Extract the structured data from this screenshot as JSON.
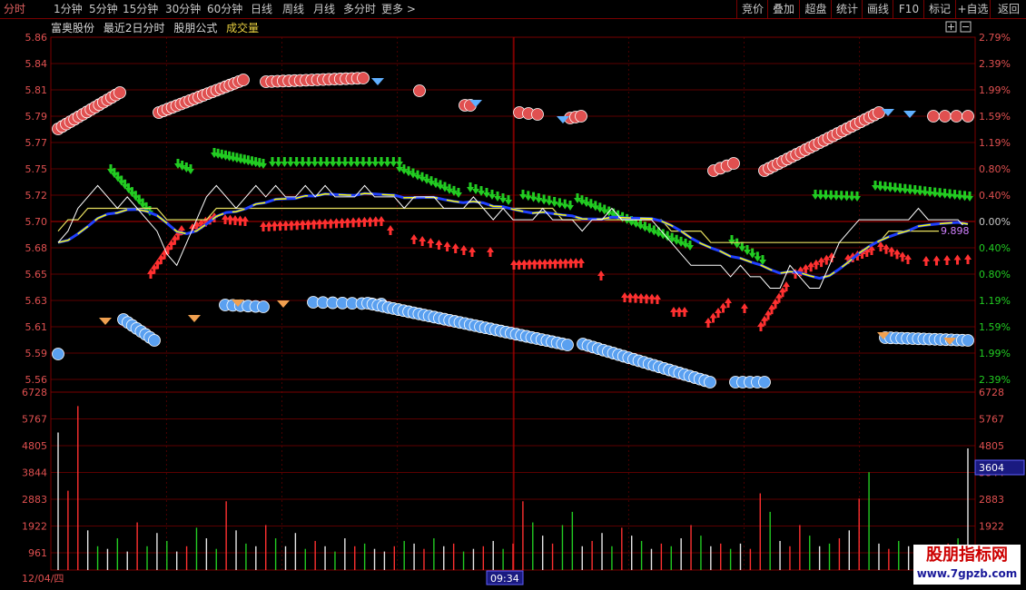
{
  "toolbar": {
    "left": [
      "分时",
      "1分钟",
      "5分钟",
      "15分钟",
      "30分钟",
      "60分钟",
      "日线",
      "周线",
      "月线",
      "多分时",
      "更多 >"
    ],
    "right": [
      "竞价",
      "叠加",
      "超盘",
      "统计",
      "画线",
      "F10",
      "标记",
      "+自选",
      "返回"
    ]
  },
  "info": {
    "stock": "富奥股份",
    "mode": "最近2日分时",
    "formula": "股朋公式",
    "indicator": "成交量"
  },
  "price_axis": {
    "left": [
      "5.86",
      "5.84",
      "5.81",
      "5.79",
      "5.77",
      "5.75",
      "5.72",
      "5.70",
      "5.68",
      "5.65",
      "5.63",
      "5.61",
      "5.59",
      "5.56"
    ],
    "right": [
      "2.79%",
      "2.39%",
      "1.99%",
      "1.59%",
      "1.19%",
      "0.80%",
      "0.40%",
      "0.00%",
      "0.40%",
      "0.80%",
      "1.19%",
      "1.59%",
      "1.99%",
      "2.39%"
    ],
    "last_label": "9.898"
  },
  "volume_axis": {
    "ticks": [
      "6728",
      "5767",
      "4805",
      "3844",
      "2883",
      "1922",
      "961"
    ],
    "current": "3604"
  },
  "time_axis": {
    "date": "12/04/四",
    "cursor": "09:34"
  },
  "colors": {
    "grid": "#7a0000",
    "up": "#ff3030",
    "down": "#22cc22",
    "price_line": "#ffffff",
    "avg_line": "#ffff00",
    "ma_blue": "#2040ff",
    "sell_ball": "#e05050",
    "buy_ball": "#5aa0f0"
  },
  "chart_data": {
    "type": "line",
    "price_range": [
      5.56,
      5.86
    ],
    "prev_close": 5.7,
    "volume_range": [
      0,
      6728
    ],
    "price": [
      5.68,
      5.69,
      5.71,
      5.72,
      5.73,
      5.72,
      5.71,
      5.72,
      5.71,
      5.7,
      5.69,
      5.67,
      5.66,
      5.68,
      5.7,
      5.72,
      5.73,
      5.72,
      5.71,
      5.72,
      5.73,
      5.72,
      5.73,
      5.72,
      5.72,
      5.73,
      5.72,
      5.73,
      5.72,
      5.72,
      5.72,
      5.73,
      5.72,
      5.72,
      5.72,
      5.71,
      5.72,
      5.72,
      5.72,
      5.71,
      5.71,
      5.71,
      5.72,
      5.71,
      5.7,
      5.71,
      5.7,
      5.7,
      5.7,
      5.71,
      5.7,
      5.7,
      5.7,
      5.69,
      5.7,
      5.7,
      5.71,
      5.7,
      5.7,
      5.7,
      5.7,
      5.69,
      5.68,
      5.67,
      5.66,
      5.66,
      5.66,
      5.66,
      5.65,
      5.66,
      5.65,
      5.65,
      5.64,
      5.64,
      5.66,
      5.65,
      5.64,
      5.64,
      5.66,
      5.68,
      5.69,
      5.7,
      5.7,
      5.7,
      5.7,
      5.7,
      5.7,
      5.71,
      5.7,
      5.7,
      5.7,
      5.7,
      5.69
    ],
    "avg": [
      5.69,
      5.7,
      5.7,
      5.71,
      5.71,
      5.71,
      5.71,
      5.71,
      5.71,
      5.71,
      5.71,
      5.7,
      5.7,
      5.7,
      5.7,
      5.7,
      5.71,
      5.71,
      5.71,
      5.71,
      5.71,
      5.71,
      5.71,
      5.71,
      5.71,
      5.71,
      5.71,
      5.71,
      5.71,
      5.71,
      5.71,
      5.71,
      5.71,
      5.71,
      5.71,
      5.71,
      5.71,
      5.71,
      5.71,
      5.71,
      5.71,
      5.71,
      5.71,
      5.71,
      5.71,
      5.71,
      5.71,
      5.71,
      5.71,
      5.71,
      5.71,
      5.7,
      5.7,
      5.7,
      5.7,
      5.7,
      5.7,
      5.7,
      5.7,
      5.7,
      5.7,
      5.7,
      5.69,
      5.69,
      5.69,
      5.69,
      5.68,
      5.68,
      5.68,
      5.68,
      5.68,
      5.68,
      5.68,
      5.68,
      5.68,
      5.68,
      5.68,
      5.68,
      5.68,
      5.68,
      5.68,
      5.68,
      5.68,
      5.68,
      5.69,
      5.69,
      5.69,
      5.69,
      5.69,
      5.69,
      5.69,
      5.69,
      5.69
    ],
    "volume": [
      5200,
      3000,
      6200,
      1500,
      900,
      800,
      1200,
      700,
      1800,
      900,
      1400,
      1100,
      700,
      900,
      1600,
      1200,
      800,
      2600,
      1500,
      1000,
      900,
      1700,
      1200,
      900,
      1400,
      800,
      1100,
      900,
      700,
      1200,
      900,
      1000,
      800,
      700,
      900,
      1100,
      1000,
      800,
      1200,
      900,
      1000,
      700,
      800,
      900,
      1100,
      800,
      1000,
      2600,
      1800,
      1300,
      1000,
      1700,
      2200,
      900,
      1100,
      1400,
      900,
      1600,
      1300,
      1100,
      800,
      1000,
      900,
      1200,
      1700,
      1300,
      900,
      1000,
      800,
      1000,
      800,
      2900,
      2200,
      1100,
      900,
      1700,
      1300,
      900,
      1000,
      1200,
      1500,
      2700,
      3700,
      1000,
      800,
      1100,
      900,
      700,
      900,
      800,
      1000,
      1200,
      4600
    ],
    "volume_colors": [
      "w",
      "r",
      "r",
      "w",
      "g",
      "w",
      "g",
      "w",
      "r",
      "g",
      "w",
      "g",
      "w",
      "r",
      "g",
      "w",
      "g",
      "r",
      "w",
      "g",
      "w",
      "r",
      "g",
      "w",
      "w",
      "g",
      "r",
      "w",
      "g",
      "w",
      "r",
      "g",
      "w",
      "w",
      "r",
      "g",
      "w",
      "r",
      "g",
      "w",
      "r",
      "g",
      "w",
      "r",
      "w",
      "g",
      "r",
      "r",
      "g",
      "w",
      "r",
      "g",
      "g",
      "w",
      "r",
      "w",
      "g",
      "r",
      "w",
      "g",
      "w",
      "r",
      "g",
      "w",
      "r",
      "g",
      "w",
      "r",
      "g",
      "w",
      "r",
      "r",
      "g",
      "w",
      "r",
      "r",
      "g",
      "w",
      "g",
      "r",
      "w",
      "r",
      "g",
      "w",
      "r",
      "g",
      "w",
      "r",
      "g",
      "w",
      "r",
      "g",
      "w",
      "g"
    ]
  }
}
